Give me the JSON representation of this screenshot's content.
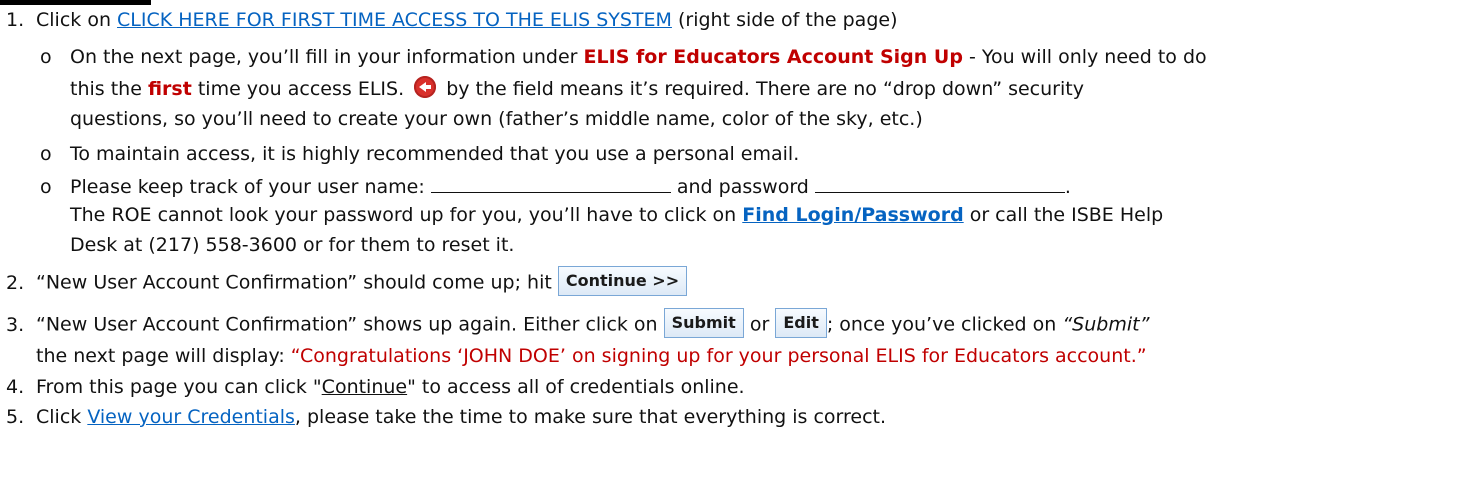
{
  "step1": {
    "num": "1.",
    "pre": "Click on ",
    "link": "CLICK HERE FOR FIRST TIME ACCESS TO THE ELIS SYSTEM",
    "post": " (right side of the page)"
  },
  "bullet_marker": "o",
  "b1": {
    "l1_pre": "On the next page, you’ll fill in your information under ",
    "l1_bold": "ELIS for Educators Account Sign Up",
    "l1_post": " - You will only need to do",
    "l2_pre": "this the ",
    "l2_bold": "first",
    "l2_mid": " time you access ELIS. ",
    "l2_post": " by the field means it’s required. There are no “drop down” security",
    "l3": "questions, so you’ll need to create your own (father’s middle name, color of the sky, etc.)"
  },
  "b2": {
    "text": "To maintain access, it is highly recommended that you use a personal email."
  },
  "b3": {
    "l1_pre": "Please keep track of your user name: ",
    "l1_mid": " and password ",
    "l1_end": ".",
    "l2": "The ROE cannot look your password up for you, you’ll have to click on ",
    "l2_link": "Find Login/Password",
    "l2_post": " or call the ISBE Help",
    "l3": "Desk at (217) 558-3600 or for them to reset it."
  },
  "step2": {
    "num": "2.",
    "text": "“New User Account Confirmation” should come up; hit ",
    "button": "Continue >>"
  },
  "step3": {
    "num": "3.",
    "pre": "“New User Account Confirmation” shows up again. Either click on ",
    "submit_button": "Submit",
    "or": " or ",
    "edit_button": "Edit",
    "mid": "; once you’ve clicked on ",
    "italic": "“Submit”",
    "l2_pre": "the next page will display: ",
    "l2_red": "“Congratulations ‘JOHN DOE’ on signing up for your personal ELIS for Educators account.”"
  },
  "step4": {
    "num": "4.",
    "pre": "From this page you can click \"",
    "link": "Continue",
    "post": "\" to access all of credentials online."
  },
  "step5": {
    "num": "5.",
    "pre": "Click ",
    "link": "View your Credentials",
    "post": ", please take the time to make sure that everything is correct."
  }
}
